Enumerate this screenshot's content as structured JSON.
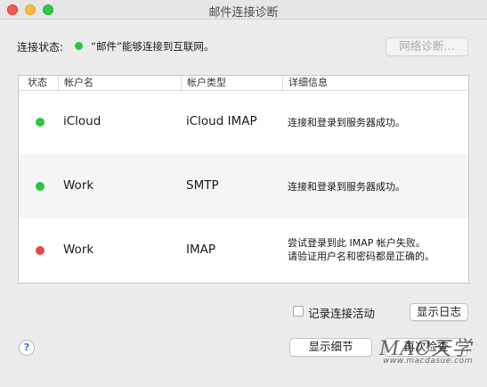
{
  "window": {
    "title": "邮件连接诊断"
  },
  "status": {
    "label": "连接状态:",
    "message": "“邮件”能够连接到互联网。",
    "dot_color": "#28c73f"
  },
  "buttons": {
    "network_diagnose": "网络诊断…",
    "show_log": "显示日志",
    "show_details": "显示细节",
    "recheck": "再次检查",
    "help": "?"
  },
  "table": {
    "headers": {
      "status": "状态",
      "account_name": "帐户名",
      "account_type": "帐户类型",
      "details": "详细信息"
    },
    "rows": [
      {
        "status_color": "#28c73f",
        "name": "iCloud",
        "type": "iCloud IMAP",
        "info_line1": "连接和登录到服务器成功。",
        "info_line2": ""
      },
      {
        "status_color": "#28c73f",
        "name": "Work",
        "type": "SMTP",
        "info_line1": "连接和登录到服务器成功。",
        "info_line2": ""
      },
      {
        "status_color": "#e5484d",
        "name": "Work",
        "type": "IMAP",
        "info_line1": "尝试登录到此 IMAP 帐户失败。",
        "info_line2": "请验证用户名和密码都是正确的。"
      }
    ]
  },
  "log_activity": {
    "label": "记录连接活动",
    "checked": false
  },
  "watermark": {
    "main": "MAC天学",
    "sub": "www.macdasue.com"
  }
}
